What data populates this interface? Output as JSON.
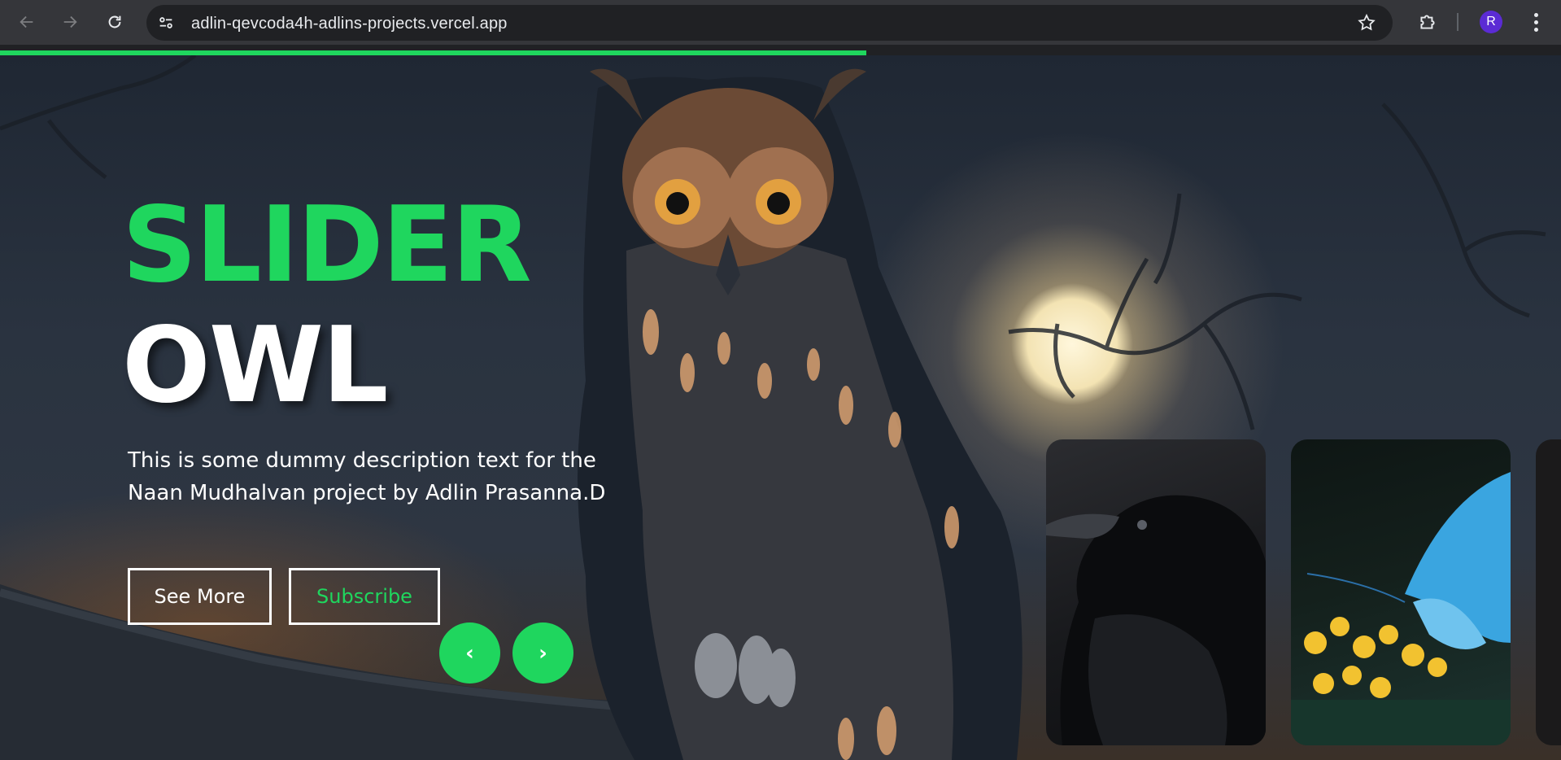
{
  "browser": {
    "url": "adlin-qevcoda4h-adlins-projects.vercel.app",
    "profile_initial": "R",
    "icons": [
      "back-arrow-icon",
      "forward-arrow-icon",
      "reload-icon",
      "site-settings-icon",
      "bookmark-star-icon",
      "extensions-puzzle-icon",
      "kebab-menu-icon"
    ]
  },
  "progress": {
    "fraction": 0.555,
    "color": "#1fd65e"
  },
  "hero": {
    "title_line1": "SLIDER",
    "title_line2": "OWL",
    "description": "This is some dummy description text for the Naan Mudhalvan project by Adlin Prasanna.D",
    "buttons": {
      "see_more": "See More",
      "subscribe": "Subscribe"
    },
    "arrows": {
      "prev": "‹",
      "next": "›"
    },
    "accent_color": "#1fd65e"
  },
  "thumbnails": [
    {
      "subject": "crow"
    },
    {
      "subject": "blue butterfly on yellow flowers"
    },
    {
      "subject": "partially visible card"
    }
  ]
}
